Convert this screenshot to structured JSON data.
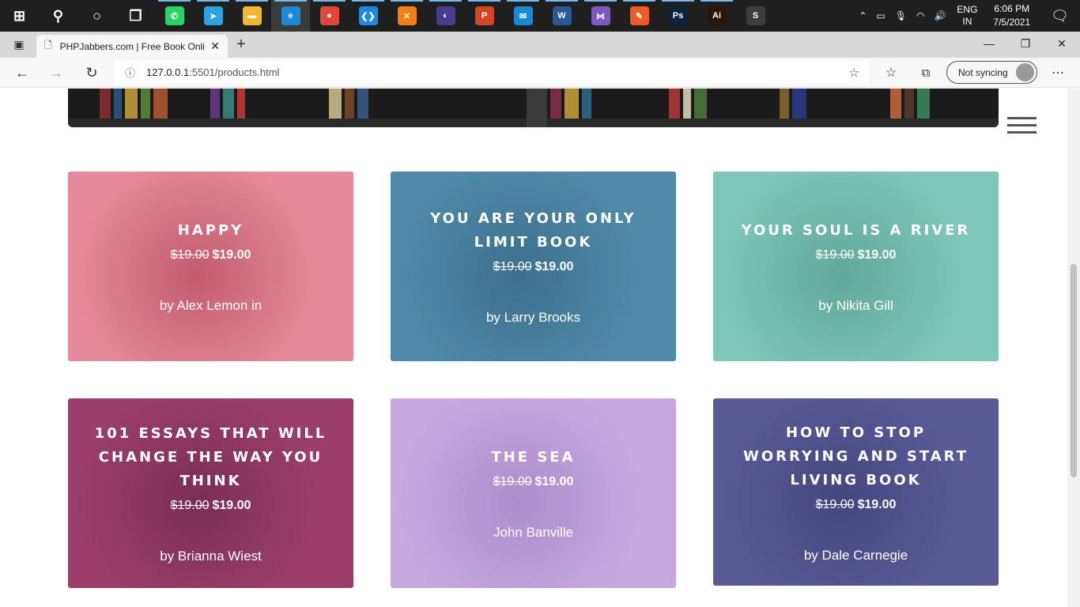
{
  "taskbar": {
    "apps": [
      {
        "name": "windows-start-icon",
        "glyph": "⊞",
        "color": "#1f1f1f"
      },
      {
        "name": "search-icon",
        "glyph": "⚲",
        "color": "#1f1f1f"
      },
      {
        "name": "cortana-icon",
        "glyph": "○",
        "color": "#1f1f1f"
      },
      {
        "name": "task-view-icon",
        "glyph": "❐",
        "color": "#1f1f1f"
      },
      {
        "name": "whatsapp-icon",
        "glyph": "✆",
        "color": "#25d366"
      },
      {
        "name": "telegram-icon",
        "glyph": "➤",
        "color": "#2aa3df"
      },
      {
        "name": "file-explorer-icon",
        "glyph": "▬",
        "color": "#f2b632"
      },
      {
        "name": "edge-icon",
        "glyph": "e",
        "color": "#1a8ad4"
      },
      {
        "name": "chrome-icon",
        "glyph": "●",
        "color": "#e0463a"
      },
      {
        "name": "vscode-icon",
        "glyph": "❮❯",
        "color": "#1e88e5"
      },
      {
        "name": "xampp-icon",
        "glyph": "✕",
        "color": "#f57f17"
      },
      {
        "name": "eclipse-icon",
        "glyph": "◐",
        "color": "#4a3c8c"
      },
      {
        "name": "powerpoint-icon",
        "glyph": "P",
        "color": "#d24726"
      },
      {
        "name": "mail-icon",
        "glyph": "✉",
        "color": "#1a8ad4"
      },
      {
        "name": "word-icon",
        "glyph": "W",
        "color": "#2b5797"
      },
      {
        "name": "visual-studio-icon",
        "glyph": "⋈",
        "color": "#7e57c2"
      },
      {
        "name": "postman-icon",
        "glyph": "✎",
        "color": "#ef5b25"
      },
      {
        "name": "photoshop-icon",
        "glyph": "Ps",
        "color": "#0c2340"
      },
      {
        "name": "illustrator-icon",
        "glyph": "Ai",
        "color": "#2b1606"
      },
      {
        "name": "sublime-icon",
        "glyph": "S",
        "color": "#3d3d3d"
      }
    ],
    "tray": {
      "lang_top": "ENG",
      "lang_bottom": "IN",
      "time": "6:06 PM",
      "date": "7/5/2021"
    }
  },
  "browser": {
    "tab_title": "PHPJabbers.com | Free Book Onli",
    "url_host": "127.0.0.1",
    "url_path": ":5501/products.html",
    "sync_label": "Not syncing"
  },
  "products": [
    {
      "title": "Happy",
      "old_price": "$19.00",
      "new_price": "$19.00",
      "author": "by Alex Lemon in",
      "bg": "#e58a9c",
      "accent": "#c45a6e"
    },
    {
      "title": "You are your only limit book",
      "old_price": "$19.00",
      "new_price": "$19.00",
      "author": "by Larry Brooks",
      "bg": "#4f8ba8",
      "accent": "#3c6f8e"
    },
    {
      "title": "Your soul is a river",
      "old_price": "$19.00",
      "new_price": "$19.00",
      "author": "by Nikita Gill",
      "bg": "#7fc7b8",
      "accent": "#5fa89a"
    },
    {
      "title": "101 essays that will change the way you think",
      "old_price": "$19.00",
      "new_price": "$19.00",
      "author": "by Brianna Wiest",
      "bg": "#9b3f6a",
      "accent": "#7a2e54"
    },
    {
      "title": "The Sea",
      "old_price": "$19.00",
      "new_price": "$19.00",
      "author": "John Banville",
      "bg": "#c8a9df",
      "accent": "#ad8ccb"
    },
    {
      "title": "How to stop worrying and start living book",
      "old_price": "$19.00",
      "new_price": "$19.00",
      "author": "by Dale Carnegie",
      "bg": "#5a5a96",
      "accent": "#454580"
    }
  ]
}
